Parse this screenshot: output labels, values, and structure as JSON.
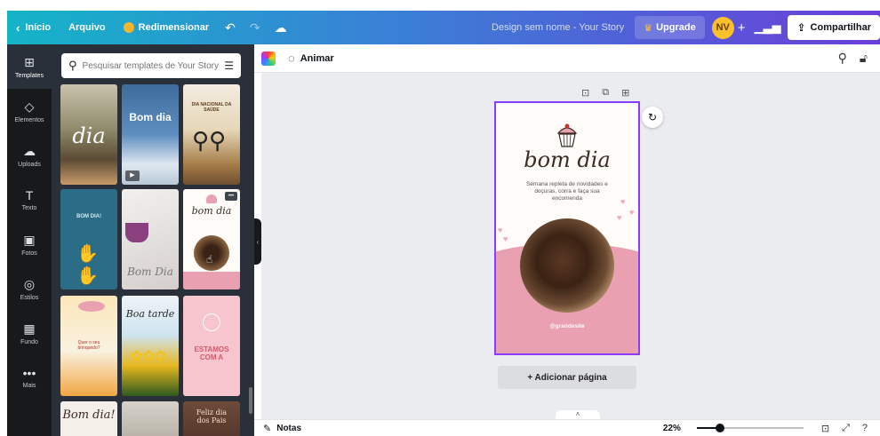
{
  "topbar": {
    "home_label": "Início",
    "file_label": "Arquivo",
    "resize_label": "Redimensionar",
    "document_title": "Design sem nome - Your Story",
    "upgrade_label": "Upgrade",
    "avatar_initials": "NV",
    "share_label": "Compartilhar"
  },
  "rail": {
    "items": [
      {
        "label": "Templates",
        "icon": "layout-icon"
      },
      {
        "label": "Elementos",
        "icon": "shapes-icon"
      },
      {
        "label": "Uploads",
        "icon": "cloud-upload-icon"
      },
      {
        "label": "Texto",
        "icon": "text-icon"
      },
      {
        "label": "Fotos",
        "icon": "image-icon"
      },
      {
        "label": "Estilos",
        "icon": "palette-icon"
      },
      {
        "label": "Fundo",
        "icon": "pattern-icon"
      },
      {
        "label": "Mais",
        "icon": "more-icon"
      }
    ]
  },
  "panel": {
    "search_placeholder": "Pesquisar templates de Your Story",
    "thumbs": [
      {
        "text": "dia"
      },
      {
        "text": "Bom dia"
      },
      {
        "text": "DIA NACIONAL DA SAÚDE"
      },
      {
        "text": "BOM DIA!"
      },
      {
        "text": "Bom Dia"
      },
      {
        "text": "bom dia"
      },
      {
        "text": "Quer o seu brinquedo?"
      },
      {
        "text": "Boa tarde"
      },
      {
        "text": "ESTAMOS COM A"
      },
      {
        "text": "Bom dia!"
      },
      {
        "text": ""
      },
      {
        "text": "Feliz dia dos Pais"
      }
    ]
  },
  "toolbar": {
    "animate_label": "Animar"
  },
  "design": {
    "title": "bom dia",
    "body": "Semana repleta de novidades e doçuras, corra e faça sua encomenda",
    "handle": "@grandesite"
  },
  "canvas": {
    "add_page_label": "+ Adicionar página"
  },
  "bottombar": {
    "notes_label": "Notas",
    "zoom_label": "22%",
    "zoom_level": 0.22,
    "help_label": "?"
  },
  "colors": {
    "accent": "#8b3dff",
    "rail_bg": "#18191b",
    "panel_bg": "#293039",
    "canvas_bg": "#ebecf0",
    "design_pink": "#e9a1b2"
  }
}
